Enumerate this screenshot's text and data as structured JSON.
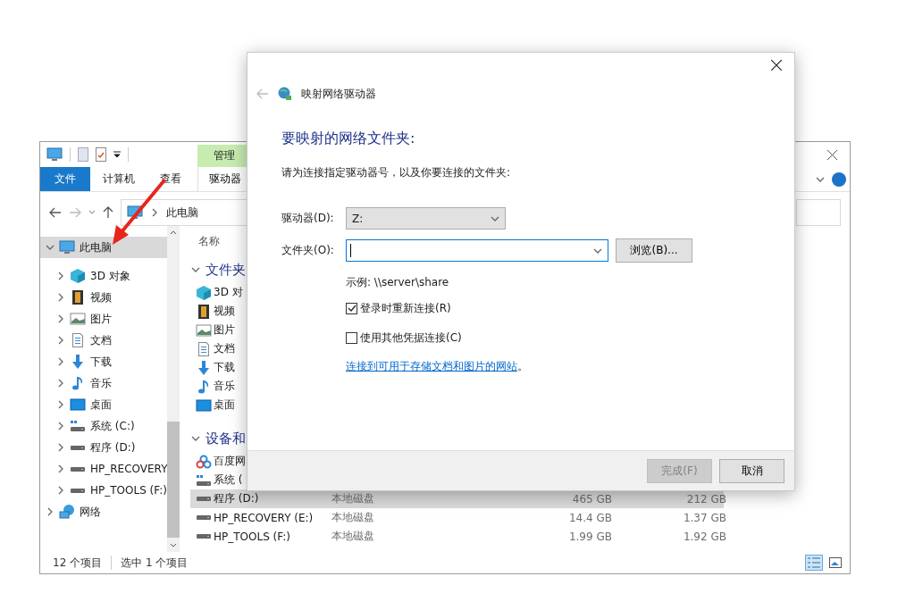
{
  "explorer": {
    "context_tab": {
      "header": "管理",
      "label": "驱动器"
    },
    "ribbon_tabs": [
      {
        "label": "文件",
        "kind": "file"
      },
      {
        "label": "计算机",
        "kind": "tab"
      },
      {
        "label": "查看",
        "kind": "tab"
      }
    ],
    "address": {
      "path": "此电脑"
    },
    "nav_pane": {
      "items": [
        {
          "label": "此电脑",
          "kind": "computer",
          "selected": true,
          "expanded": true,
          "children": [
            {
              "label": "3D 对象",
              "kind": "cube",
              "selected": false,
              "expanded": false
            },
            {
              "label": "视频",
              "kind": "film",
              "selected": false,
              "expanded": false
            },
            {
              "label": "图片",
              "kind": "picture",
              "selected": false,
              "expanded": false
            },
            {
              "label": "文档",
              "kind": "document",
              "selected": false,
              "expanded": false
            },
            {
              "label": "下载",
              "kind": "download",
              "selected": false,
              "expanded": false
            },
            {
              "label": "音乐",
              "kind": "music",
              "selected": false,
              "expanded": false
            },
            {
              "label": "桌面",
              "kind": "desktop",
              "selected": false,
              "expanded": false
            },
            {
              "label": "系统 (C:)",
              "kind": "system-drive",
              "selected": false,
              "expanded": false
            },
            {
              "label": "程序 (D:)",
              "kind": "drive",
              "selected": false,
              "expanded": false
            },
            {
              "label": "HP_RECOVERY",
              "kind": "drive",
              "selected": false,
              "expanded": false
            },
            {
              "label": "HP_TOOLS (F:)",
              "kind": "drive",
              "selected": false,
              "expanded": false
            }
          ]
        },
        {
          "label": "网络",
          "kind": "network",
          "selected": false,
          "expanded": false
        }
      ]
    },
    "content": {
      "column_header": "名称",
      "groups": [
        {
          "title": "文件夹",
          "items": [
            {
              "name": "3D 对",
              "kind": "cube",
              "selected": false
            },
            {
              "name": "视频",
              "kind": "film",
              "selected": false
            },
            {
              "name": "图片",
              "kind": "picture",
              "selected": false
            },
            {
              "name": "文档",
              "kind": "document",
              "selected": false
            },
            {
              "name": "下载",
              "kind": "download",
              "selected": false
            },
            {
              "name": "音乐",
              "kind": "music",
              "selected": false
            },
            {
              "name": "桌面",
              "kind": "desktop",
              "selected": false
            }
          ]
        },
        {
          "title": "设备和",
          "items": [
            {
              "name": "百度网",
              "kind": "cloud",
              "selected": false
            },
            {
              "name": "系统 (",
              "kind": "system-drive",
              "selected": false
            },
            {
              "name": "程序 (D:)",
              "kind": "drive",
              "selected": true,
              "type": "本地磁盘",
              "total": "465 GB",
              "free": "212 GB"
            },
            {
              "name": "HP_RECOVERY (E:)",
              "kind": "drive",
              "selected": false,
              "type": "本地磁盘",
              "total": "14.4 GB",
              "free": "1.37 GB"
            },
            {
              "name": "HP_TOOLS (F:)",
              "kind": "drive",
              "selected": false,
              "type": "本地磁盘",
              "total": "1.99 GB",
              "free": "1.92 GB"
            }
          ]
        }
      ]
    },
    "status_bar": {
      "item_count": "12 个项目",
      "selection": "选中 1 个项目"
    }
  },
  "dialog": {
    "title": "映射网络驱动器",
    "heading": "要映射的网络文件夹:",
    "description": "请为连接指定驱动器号，以及你要连接的文件夹:",
    "drive": {
      "label": "驱动器(D):",
      "value": "Z:"
    },
    "folder": {
      "label": "文件夹(O):"
    },
    "browse_button": "浏览(B)...",
    "example": "示例: \\\\server\\share",
    "options": [
      {
        "label": "登录时重新连接(R)",
        "checked": true
      },
      {
        "label": "使用其他凭据连接(C)",
        "checked": false
      }
    ],
    "link": {
      "text": "连接到可用于存储文档和图片的网站",
      "suffix": "。"
    },
    "buttons": [
      {
        "label": "完成(F)",
        "disabled": true
      },
      {
        "label": "取消",
        "disabled": false
      }
    ]
  }
}
